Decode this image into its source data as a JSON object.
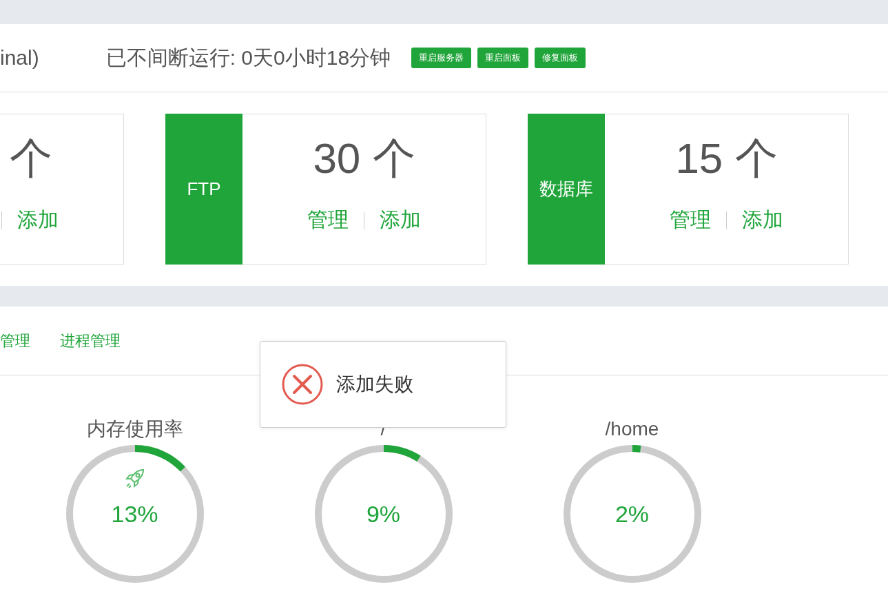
{
  "header": {
    "version_tail": "inal)",
    "uptime": "已不间断运行: 0天0小时18分钟",
    "buttons": [
      "重启服务器",
      "重启面板",
      "修复面板"
    ]
  },
  "stat_cards": [
    {
      "kind": "cut",
      "count": "个",
      "links": [
        "添加"
      ]
    },
    {
      "kind": "full",
      "label": "FTP",
      "count": "30 个",
      "links": [
        "管理",
        "添加"
      ]
    },
    {
      "kind": "full",
      "label": "数据库",
      "count": "15 个",
      "links": [
        "管理",
        "添加"
      ]
    }
  ],
  "tabs": [
    "管理",
    "进程管理"
  ],
  "gauges": [
    {
      "title": "内存使用率",
      "level": 0.13,
      "reading": "13%",
      "boost": true
    },
    {
      "title": "/",
      "level": 0.09,
      "reading": "9%",
      "boost": false
    },
    {
      "title": "/home",
      "level": 0.02,
      "reading": "2%",
      "boost": false
    }
  ],
  "toast": {
    "kind": "error",
    "message": "添加失败"
  }
}
